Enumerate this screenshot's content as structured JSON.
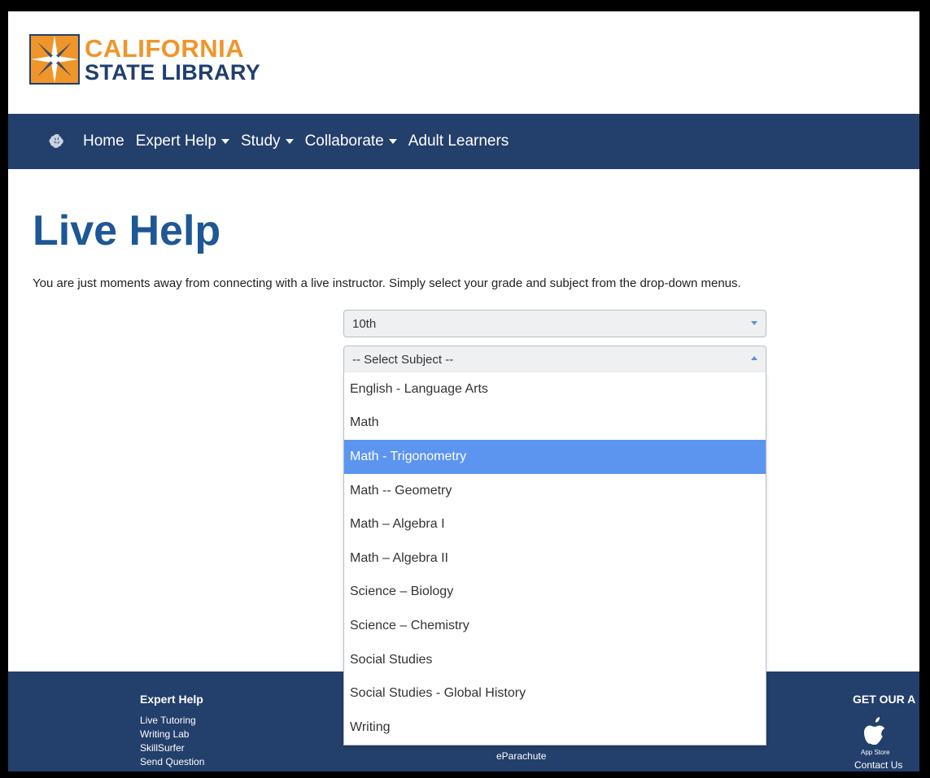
{
  "header": {
    "logo_line1": "CALIFORNIA",
    "logo_line2": "STATE LIBRARY"
  },
  "nav": {
    "icon": "brain-icon",
    "items": [
      {
        "label": "Home",
        "dropdown": false
      },
      {
        "label": "Expert Help",
        "dropdown": true
      },
      {
        "label": "Study",
        "dropdown": true
      },
      {
        "label": "Collaborate",
        "dropdown": true
      },
      {
        "label": "Adult Learners",
        "dropdown": false
      }
    ]
  },
  "main": {
    "title": "Live Help",
    "intro": "You are just moments away from connecting with a live instructor. Simply select your grade and subject from the drop-down menus.",
    "grade_select": {
      "value": "10th"
    },
    "subject_select": {
      "value": "-- Select Subject --",
      "options": [
        "English - Language Arts",
        "Math",
        "Math - Trigonometry",
        "Math -- Geometry",
        "Math – Algebra I",
        "Math – Algebra II",
        "Science – Biology",
        "Science – Chemistry",
        "Social Studies",
        "Social Studies - Global History",
        "Writing"
      ],
      "highlighted": "Math - Trigonometry"
    }
  },
  "footer": {
    "expert_help": {
      "heading": "Expert Help",
      "links": [
        "Live Tutoring",
        "Writing Lab",
        "SkillSurfer",
        "Send Question"
      ]
    },
    "mid_link": "eParachute",
    "app": {
      "heading": "GET OUR A",
      "store_label": "App Store",
      "contact": "Contact Us"
    }
  },
  "colors": {
    "nav_bg": "#233f6b",
    "title_blue": "#1e5795",
    "logo_orange": "#f0952a",
    "highlight": "#5b95f0"
  }
}
